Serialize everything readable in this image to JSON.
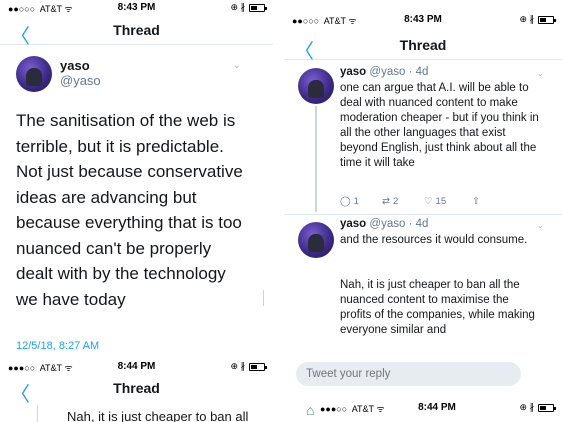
{
  "status_top": {
    "signal": "●●○○○",
    "carrier": "AT&T",
    "wifi": "ᯤ",
    "time": "8:43 PM",
    "icons": "⊕ ∦"
  },
  "status_bottom": {
    "signal": "●●●○○",
    "carrier": "AT&T",
    "wifi": "ᯤ",
    "time": "8:44 PM",
    "icons": "⊕ ∦"
  },
  "nav": {
    "title": "Thread",
    "back_icon": "chevron-left-icon",
    "back_glyph": "〈"
  },
  "detail_tweet": {
    "name": "yaso",
    "handle": "@yaso",
    "text": "The sanitisation of the web is terrible, but it is predictable. Not just because conservative ideas are advancing but because everything that is too nuanced can't be properly dealt with by the technology we have today",
    "timestamp": "12/5/18, 8:27 AM",
    "menu_glyph": "⌄"
  },
  "bottom_strip": {
    "text": "Nah, it is just cheaper to ban all"
  },
  "thread": [
    {
      "name": "yaso",
      "meta": "@yaso · 4d",
      "text": "one can argue that A.I. will be able to deal with nuanced content to make moderation cheaper - but if you think in all the other languages that exist beyond English, just think about all the time it will take",
      "replies": "1",
      "retweets": "2",
      "likes": "15",
      "reply_glyph": "◯",
      "retweet_glyph": "⇄",
      "like_glyph": "♡",
      "share_glyph": "⇧"
    },
    {
      "name": "yaso",
      "meta": "@yaso · 4d",
      "text": "and the resources it would consume.",
      "text2": "Nah, it is just cheaper to ban all the nuanced content to maximise the profits of the companies, while making everyone similar and"
    }
  ],
  "reply_box": {
    "placeholder": "Tweet your reply"
  },
  "home_icon_glyph": "⌂",
  "colors": {
    "accent": "#1da1f2",
    "muted": "#657786",
    "text": "#14171a"
  }
}
